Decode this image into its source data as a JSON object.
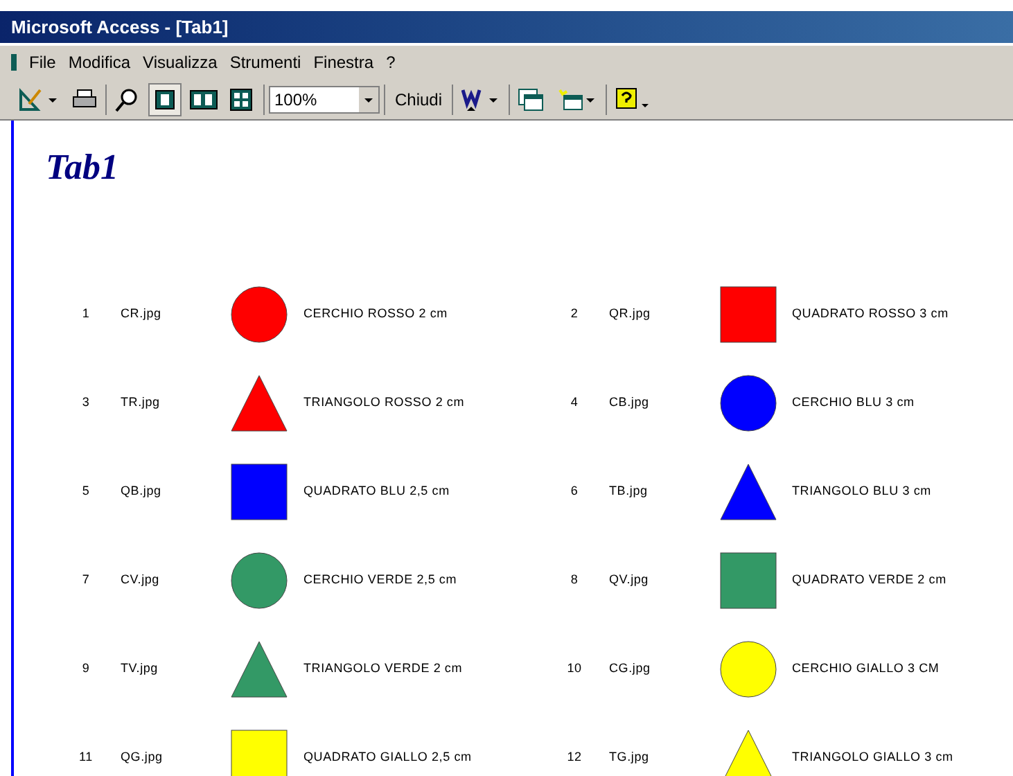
{
  "window": {
    "title": "Microsoft Access - [Tab1]"
  },
  "menu": [
    "File",
    "Modifica",
    "Visualizza",
    "Strumenti",
    "Finestra",
    "?"
  ],
  "toolbar": {
    "zoom": "100%",
    "close_button": "Chiudi"
  },
  "report": {
    "title": "Tab1",
    "records": [
      {
        "number": "1",
        "file": "CR.jpg",
        "kind": "circle",
        "color": "#ff0000",
        "description": "CERCHIO ROSSO 2 cm"
      },
      {
        "number": "2",
        "file": "QR.jpg",
        "kind": "square",
        "color": "#ff0000",
        "description": "QUADRATO ROSSO 3 cm"
      },
      {
        "number": "3",
        "file": "TR.jpg",
        "kind": "triangle",
        "color": "#ff0000",
        "description": "TRIANGOLO ROSSO 2 cm"
      },
      {
        "number": "4",
        "file": "CB.jpg",
        "kind": "circle",
        "color": "#0000ff",
        "description": "CERCHIO BLU 3 cm"
      },
      {
        "number": "5",
        "file": "QB.jpg",
        "kind": "square",
        "color": "#0000ff",
        "description": "QUADRATO BLU 2,5 cm"
      },
      {
        "number": "6",
        "file": "TB.jpg",
        "kind": "triangle",
        "color": "#0000ff",
        "description": "TRIANGOLO BLU 3 cm"
      },
      {
        "number": "7",
        "file": "CV.jpg",
        "kind": "circle",
        "color": "#339966",
        "description": "CERCHIO VERDE 2,5 cm"
      },
      {
        "number": "8",
        "file": "QV.jpg",
        "kind": "square",
        "color": "#339966",
        "description": "QUADRATO VERDE 2 cm"
      },
      {
        "number": "9",
        "file": "TV.jpg",
        "kind": "triangle",
        "color": "#339966",
        "description": "TRIANGOLO VERDE 2 cm"
      },
      {
        "number": "10",
        "file": "CG.jpg",
        "kind": "circle",
        "color": "#ffff00",
        "description": "CERCHIO GIALLO 3 CM"
      },
      {
        "number": "11",
        "file": "QG.jpg",
        "kind": "square",
        "color": "#ffff00",
        "description": "QUADRATO GIALLO 2,5 cm"
      },
      {
        "number": "12",
        "file": "TG.jpg",
        "kind": "triangle",
        "color": "#ffff00",
        "description": "TRIANGOLO GIALLO 3 cm"
      }
    ]
  }
}
